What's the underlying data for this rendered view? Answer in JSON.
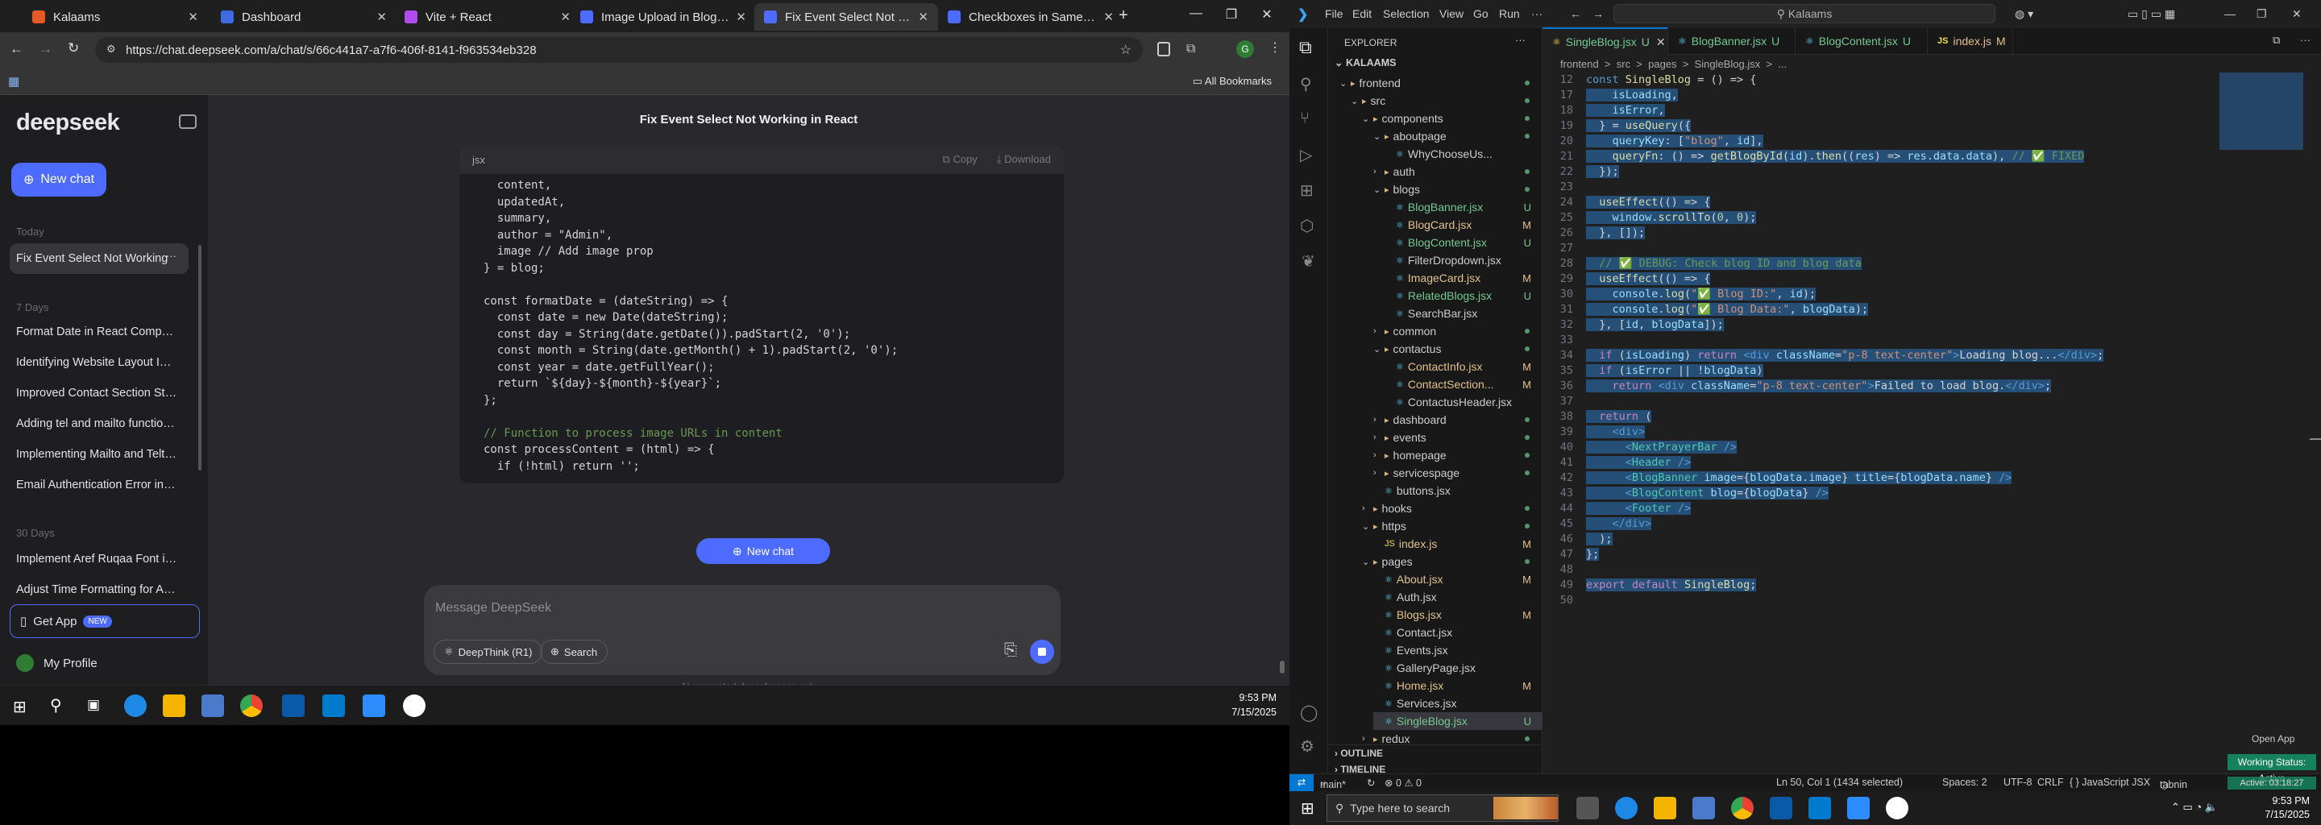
{
  "chrome": {
    "tabs": [
      {
        "label": "Kalaams",
        "color": "#e05a2a"
      },
      {
        "label": "Dashboard",
        "color": "#3f6be0"
      },
      {
        "label": "Vite + React",
        "color": "#b04bf0"
      },
      {
        "label": "Image Upload in Blog Editor",
        "color": "#4d6bfe"
      },
      {
        "label": "Fix Event Select Not Working",
        "color": "#4d6bfe"
      },
      {
        "label": "Checkboxes in Same Row",
        "color": "#4d6bfe"
      }
    ],
    "url": "https://chat.deepseek.com/a/chat/s/66c441a7-a7f6-406f-8141-f963534eb328",
    "all_bookmarks": "All Bookmarks",
    "profile_initial": "G"
  },
  "deepseek": {
    "logo": "deepseek",
    "new_chat": "New chat",
    "sections": {
      "today": "Today",
      "week": "7 Days",
      "month": "30 Days"
    },
    "today_items": [
      "Fix Event Select Not Working"
    ],
    "week_items": [
      "Format Date in React Component",
      "Identifying Website Layout Imag",
      "Improved Contact Section Styling",
      "Adding tel and mailto functional",
      "Implementing Mailto and Telto F",
      "Email Authentication Error in No"
    ],
    "month_items": [
      "Implement Aref Ruqaa Font in R",
      "Adjust Time Formatting for AM/I"
    ],
    "get_app": "Get App",
    "new_badge": "NEW",
    "profile": "My Profile",
    "chat_title": "Fix Event Select Not Working in React",
    "code_lang": "jsx",
    "copy": "Copy",
    "download": "Download",
    "code_lines": [
      "  content,",
      "  updatedAt,",
      "  summary,",
      "  author = \"Admin\",",
      "  image // Add image prop",
      "} = blog;",
      "",
      "const formatDate = (dateString) => {",
      "  const date = new Date(dateString);",
      "  const day = String(date.getDate()).padStart(2, '0');",
      "  const month = String(date.getMonth() + 1).padStart(2, '0');",
      "  const year = date.getFullYear();",
      "  return `${day}-${month}-${year}`;",
      "};",
      "",
      "// Function to process image URLs in content",
      "const processContent = (html) => {",
      "  if (!html) return '';"
    ],
    "new_chat_pill": "New chat",
    "placeholder": "Message DeepSeek",
    "deepthink": "DeepThink (R1)",
    "search": "Search",
    "disclaimer": "AI-generated, for reference only"
  },
  "taskbar_left": {
    "time": "9:53 PM",
    "date": "7/15/2025"
  },
  "vscode": {
    "menu": [
      "File",
      "Edit",
      "Selection",
      "View",
      "Go",
      "Run"
    ],
    "search": "Kalaams",
    "explorer_title": "EXPLORER",
    "root": "KALAAMS",
    "tabs": [
      {
        "label": "SingleBlog.jsx",
        "status": "U"
      },
      {
        "label": "BlogBanner.jsx",
        "status": "U"
      },
      {
        "label": "BlogContent.jsx",
        "status": "U"
      },
      {
        "label": "index.js",
        "status": "M"
      }
    ],
    "breadcrumb": "frontend  >  src  >  pages  >  SingleBlog.jsx  >  ...",
    "tree": [
      {
        "label": "frontend",
        "depth": 0,
        "type": "open",
        "stat": ""
      },
      {
        "label": "src",
        "depth": 1,
        "type": "open",
        "stat": ""
      },
      {
        "label": "components",
        "depth": 2,
        "type": "open",
        "stat": ""
      },
      {
        "label": "aboutpage",
        "depth": 3,
        "type": "open",
        "stat": ""
      },
      {
        "label": "WhyChooseUs...",
        "depth": 4,
        "type": "file",
        "stat": ""
      },
      {
        "label": "auth",
        "depth": 3,
        "type": "closed",
        "stat": ""
      },
      {
        "label": "blogs",
        "depth": 3,
        "type": "open",
        "stat": ""
      },
      {
        "label": "BlogBanner.jsx",
        "depth": 4,
        "type": "file",
        "stat": "U"
      },
      {
        "label": "BlogCard.jsx",
        "depth": 4,
        "type": "file",
        "stat": "M"
      },
      {
        "label": "BlogContent.jsx",
        "depth": 4,
        "type": "file",
        "stat": "U"
      },
      {
        "label": "FilterDropdown.jsx",
        "depth": 4,
        "type": "file",
        "stat": ""
      },
      {
        "label": "ImageCard.jsx",
        "depth": 4,
        "type": "file",
        "stat": "M"
      },
      {
        "label": "RelatedBlogs.jsx",
        "depth": 4,
        "type": "file",
        "stat": "U"
      },
      {
        "label": "SearchBar.jsx",
        "depth": 4,
        "type": "file",
        "stat": ""
      },
      {
        "label": "common",
        "depth": 3,
        "type": "closed",
        "stat": ""
      },
      {
        "label": "contactus",
        "depth": 3,
        "type": "open",
        "stat": ""
      },
      {
        "label": "ContactInfo.jsx",
        "depth": 4,
        "type": "file",
        "stat": "M"
      },
      {
        "label": "ContactSection...",
        "depth": 4,
        "type": "file",
        "stat": "M"
      },
      {
        "label": "ContactusHeader.jsx",
        "depth": 4,
        "type": "file",
        "stat": ""
      },
      {
        "label": "dashboard",
        "depth": 3,
        "type": "closed",
        "stat": ""
      },
      {
        "label": "events",
        "depth": 3,
        "type": "closed",
        "stat": ""
      },
      {
        "label": "homepage",
        "depth": 3,
        "type": "closed",
        "stat": ""
      },
      {
        "label": "servicespage",
        "depth": 3,
        "type": "closed",
        "stat": ""
      },
      {
        "label": "buttons.jsx",
        "depth": 3,
        "type": "file",
        "stat": ""
      },
      {
        "label": "hooks",
        "depth": 2,
        "type": "closed",
        "stat": ""
      },
      {
        "label": "https",
        "depth": 2,
        "type": "open",
        "stat": ""
      },
      {
        "label": "index.js",
        "depth": 3,
        "type": "file",
        "stat": "M"
      },
      {
        "label": "pages",
        "depth": 2,
        "type": "open",
        "stat": ""
      },
      {
        "label": "About.jsx",
        "depth": 3,
        "type": "file",
        "stat": "M"
      },
      {
        "label": "Auth.jsx",
        "depth": 3,
        "type": "file",
        "stat": ""
      },
      {
        "label": "Blogs.jsx",
        "depth": 3,
        "type": "file",
        "stat": "M"
      },
      {
        "label": "Contact.jsx",
        "depth": 3,
        "type": "file",
        "stat": ""
      },
      {
        "label": "Events.jsx",
        "depth": 3,
        "type": "file",
        "stat": ""
      },
      {
        "label": "GalleryPage.jsx",
        "depth": 3,
        "type": "file",
        "stat": ""
      },
      {
        "label": "Home.jsx",
        "depth": 3,
        "type": "file",
        "stat": "M"
      },
      {
        "label": "Services.jsx",
        "depth": 3,
        "type": "file",
        "stat": ""
      },
      {
        "label": "SingleBlog.jsx",
        "depth": 3,
        "type": "file",
        "stat": "U"
      },
      {
        "label": "redux",
        "depth": 2,
        "type": "closed",
        "stat": ""
      }
    ],
    "outline": "OUTLINE",
    "timeline": "TIMELINE",
    "code": [
      {
        "n": "12",
        "html": "<span class='b'>const</span> <span class='f'>SingleBlog</span> <span class='p'>= () =&gt; {</span>",
        "sel": false
      },
      {
        "n": "17",
        "html": "    <span class='v'>isLoading</span><span class='p'>,</span>",
        "sel": true
      },
      {
        "n": "18",
        "html": "    <span class='v'>isError</span><span class='p'>,</span>",
        "sel": true
      },
      {
        "n": "19",
        "html": "  <span class='p'>} = </span><span class='f'>useQuery</span><span class='p'>({</span>",
        "sel": true
      },
      {
        "n": "20",
        "html": "    <span class='v'>queryKey</span><span class='p'>: [</span><span class='s'>\"blog\"</span><span class='p'>, </span><span class='v'>id</span><span class='p'>],</span>",
        "sel": true
      },
      {
        "n": "21",
        "html": "    <span class='f'>queryFn</span><span class='p'>: () =&gt; </span><span class='f'>getBlogById</span><span class='p'>(</span><span class='v'>id</span><span class='p'>).</span><span class='f'>then</span><span class='p'>((</span><span class='v'>res</span><span class='p'>) =&gt; </span><span class='v'>res</span><span class='p'>.</span><span class='v'>data</span><span class='p'>.</span><span class='v'>data</span><span class='p'>), </span><span class='c'>// ✅ FIXED</span>",
        "sel": true
      },
      {
        "n": "22",
        "html": "  <span class='p'>});</span>",
        "sel": true
      },
      {
        "n": "23",
        "html": "",
        "sel": false
      },
      {
        "n": "24",
        "html": "  <span class='f'>useEffect</span><span class='p'>(() =&gt; {</span>",
        "sel": true
      },
      {
        "n": "25",
        "html": "    <span class='v'>window</span><span class='p'>.</span><span class='f'>scrollTo</span><span class='p'>(</span><span class='n'>0</span><span class='p'>, </span><span class='n'>0</span><span class='p'>);</span>",
        "sel": true
      },
      {
        "n": "26",
        "html": "  <span class='p'>}, []);</span>",
        "sel": true
      },
      {
        "n": "27",
        "html": "",
        "sel": false
      },
      {
        "n": "28",
        "html": "  <span class='c'>// ✅ DEBUG: Check blog ID and blog data</span>",
        "sel": true
      },
      {
        "n": "29",
        "html": "  <span class='f'>useEffect</span><span class='p'>(() =&gt; {</span>",
        "sel": true
      },
      {
        "n": "30",
        "html": "    <span class='v'>console</span><span class='p'>.</span><span class='f'>log</span><span class='p'>(</span><span class='s'>\"✅ Blog ID:\"</span><span class='p'>, </span><span class='v'>id</span><span class='p'>);</span>",
        "sel": true
      },
      {
        "n": "31",
        "html": "    <span class='v'>console</span><span class='p'>.</span><span class='f'>log</span><span class='p'>(</span><span class='s'>\"✅ Blog Data:\"</span><span class='p'>, </span><span class='v'>blogData</span><span class='p'>);</span>",
        "sel": true
      },
      {
        "n": "32",
        "html": "  <span class='p'>}, [</span><span class='v'>id</span><span class='p'>, </span><span class='v'>blogData</span><span class='p'>]);</span>",
        "sel": true
      },
      {
        "n": "33",
        "html": "",
        "sel": false
      },
      {
        "n": "34",
        "html": "  <span class='k'>if</span> <span class='p'>(</span><span class='v'>isLoading</span><span class='p'>) </span><span class='k'>return</span> <span class='b'>&lt;div</span> <span class='v'>className</span><span class='p'>=</span><span class='s'>\"p-8 text-center\"</span><span class='b'>&gt;</span><span class='p'>Loading blog...</span><span class='b'>&lt;/div&gt;</span><span class='p'>;</span>",
        "sel": true
      },
      {
        "n": "35",
        "html": "  <span class='k'>if</span> <span class='p'>(</span><span class='v'>isError</span> <span class='p'>|| !</span><span class='v'>blogData</span><span class='p'>)</span>",
        "sel": true
      },
      {
        "n": "36",
        "html": "    <span class='k'>return</span> <span class='b'>&lt;div</span> <span class='v'>className</span><span class='p'>=</span><span class='s'>\"p-8 text-center\"</span><span class='b'>&gt;</span><span class='p'>Failed to load blog.</span><span class='b'>&lt;/div&gt;</span><span class='p'>;</span>",
        "sel": true
      },
      {
        "n": "37",
        "html": "",
        "sel": false
      },
      {
        "n": "38",
        "html": "  <span class='k'>return</span> <span class='p'>(</span>",
        "sel": true
      },
      {
        "n": "39",
        "html": "    <span class='b'>&lt;div&gt;</span>",
        "sel": true
      },
      {
        "n": "40",
        "html": "      <span class='b'>&lt;</span><span class='t'>NextPrayerBar</span> <span class='b'>/&gt;</span>",
        "sel": true
      },
      {
        "n": "41",
        "html": "      <span class='b'>&lt;</span><span class='t'>Header</span> <span class='b'>/&gt;</span>",
        "sel": true
      },
      {
        "n": "42",
        "html": "      <span class='b'>&lt;</span><span class='t'>BlogBanner</span> <span class='v'>image</span><span class='p'>={</span><span class='v'>blogData</span><span class='p'>.</span><span class='v'>image</span><span class='p'>} </span><span class='v'>title</span><span class='p'>={</span><span class='v'>blogData</span><span class='p'>.</span><span class='v'>name</span><span class='p'>}</span> <span class='b'>/&gt;</span>",
        "sel": true
      },
      {
        "n": "43",
        "html": "      <span class='b'>&lt;</span><span class='t'>BlogContent</span> <span class='v'>blog</span><span class='p'>={</span><span class='v'>blogData</span><span class='p'>}</span> <span class='b'>/&gt;</span>",
        "sel": true
      },
      {
        "n": "44",
        "html": "      <span class='b'>&lt;</span><span class='t'>Footer</span> <span class='b'>/&gt;</span>",
        "sel": true
      },
      {
        "n": "45",
        "html": "    <span class='b'>&lt;/div&gt;</span>",
        "sel": true
      },
      {
        "n": "46",
        "html": "  <span class='p'>);</span>",
        "sel": true
      },
      {
        "n": "47",
        "html": "<span class='p'>};</span>",
        "sel": true
      },
      {
        "n": "48",
        "html": "",
        "sel": false
      },
      {
        "n": "49",
        "html": "<span class='k'>export</span> <span class='k'>default</span> <span class='f'>SingleBlog</span><span class='p'>;</span>",
        "sel": true
      },
      {
        "n": "50",
        "html": "",
        "sel": false
      }
    ],
    "status": {
      "branch": "main*",
      "problems": "⊗ 0  ⚠ 0",
      "cursor": "Ln 50, Col 1 (1434 selected)",
      "spaces": "Spaces: 2",
      "encoding": "UTF-8",
      "eol": "CRLF",
      "lang": "{ }  JavaScript JSX",
      "tabnine": "tabnin",
      "open_app": "Open App",
      "working": "Working Status: Active",
      "active": "Active: 03:18:27"
    }
  },
  "taskbar_right": {
    "search": "Type here to search",
    "time": "9:53 PM",
    "date": "7/15/2025"
  }
}
